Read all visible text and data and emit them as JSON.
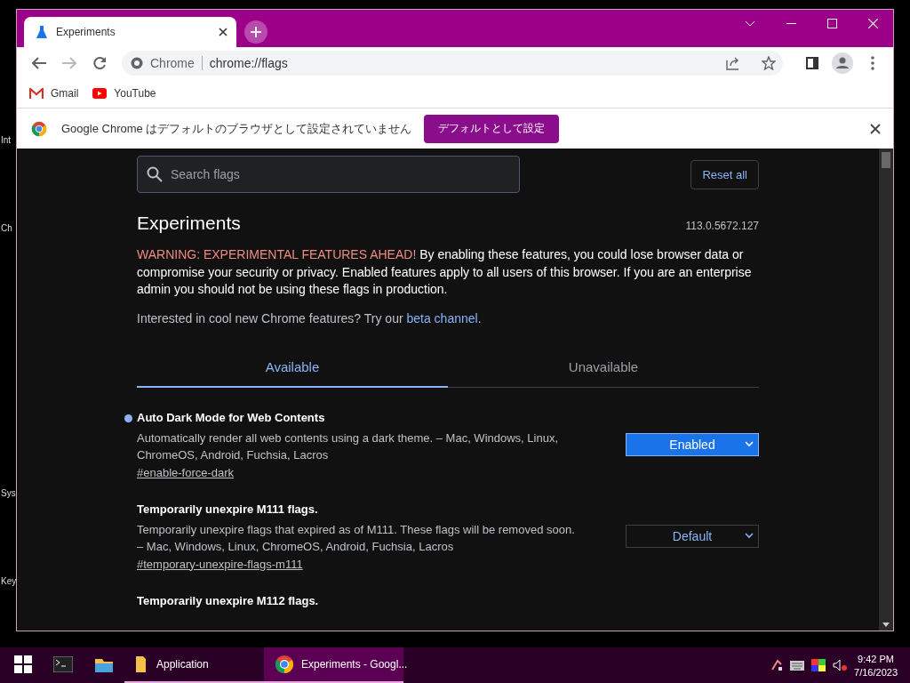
{
  "desktop_labels": [
    "Int",
    "Ch",
    "Sys",
    "Key"
  ],
  "browser": {
    "tabs": [
      {
        "title": "Experiments",
        "selected": true
      }
    ],
    "omnibox": {
      "site": "Chrome",
      "url": "chrome://flags"
    },
    "bookmarks": [
      {
        "label": "Gmail",
        "kind": "mail"
      },
      {
        "label": "YouTube",
        "kind": "video"
      }
    ],
    "infobar": {
      "message": "Google Chrome はデフォルトのブラウザとして設定されていません",
      "button": "デフォルトとして設定"
    }
  },
  "flags_page": {
    "search": {
      "placeholder": "Search flags"
    },
    "reset_button": "Reset all",
    "title": "Experiments",
    "version": "113.0.5672.127",
    "warning_label": "WARNING: EXPERIMENTAL FEATURES AHEAD!",
    "warning_text": "By enabling these features, you could lose browser data or compromise your security or privacy. Enabled features apply to all users of this browser. If you are an enterprise admin you should not be using these flags in production.",
    "interest_text": "Interested in cool new Chrome features? Try our",
    "interest_link": "beta channel",
    "interest_end": ".",
    "tabs": [
      {
        "label": "Available",
        "selected": true
      },
      {
        "label": "Unavailable",
        "selected": false
      }
    ],
    "flags": [
      {
        "name": "Auto Dark Mode for Web Contents",
        "description": "Automatically render all web contents using a dark theme. – Mac, Windows, Linux, ChromeOS, Android, Fuchsia, Lacros",
        "anchor": "#enable-force-dark",
        "value": "Enabled",
        "modified": true
      },
      {
        "name": "Temporarily unexpire M111 flags.",
        "description": "Temporarily unexpire flags that expired as of M111. These flags will be removed soon. – Mac, Windows, Linux, ChromeOS, Android, Fuchsia, Lacros",
        "anchor": "#temporary-unexpire-flags-m111",
        "value": "Default",
        "modified": false
      },
      {
        "name": "Temporarily unexpire M112 flags."
      }
    ]
  },
  "taskbar": {
    "apps": [
      {
        "kind": "terminal",
        "running": false,
        "selected": false
      },
      {
        "kind": "explorer",
        "running": false,
        "selected": false
      },
      {
        "kind": "folder",
        "label": "Application",
        "running": true,
        "selected": false
      },
      {
        "kind": "chrome",
        "label": "Experiments - Googl...",
        "running": true,
        "selected": true
      }
    ],
    "clock": {
      "time": "9:42 PM",
      "date": "7/16/2023"
    }
  }
}
